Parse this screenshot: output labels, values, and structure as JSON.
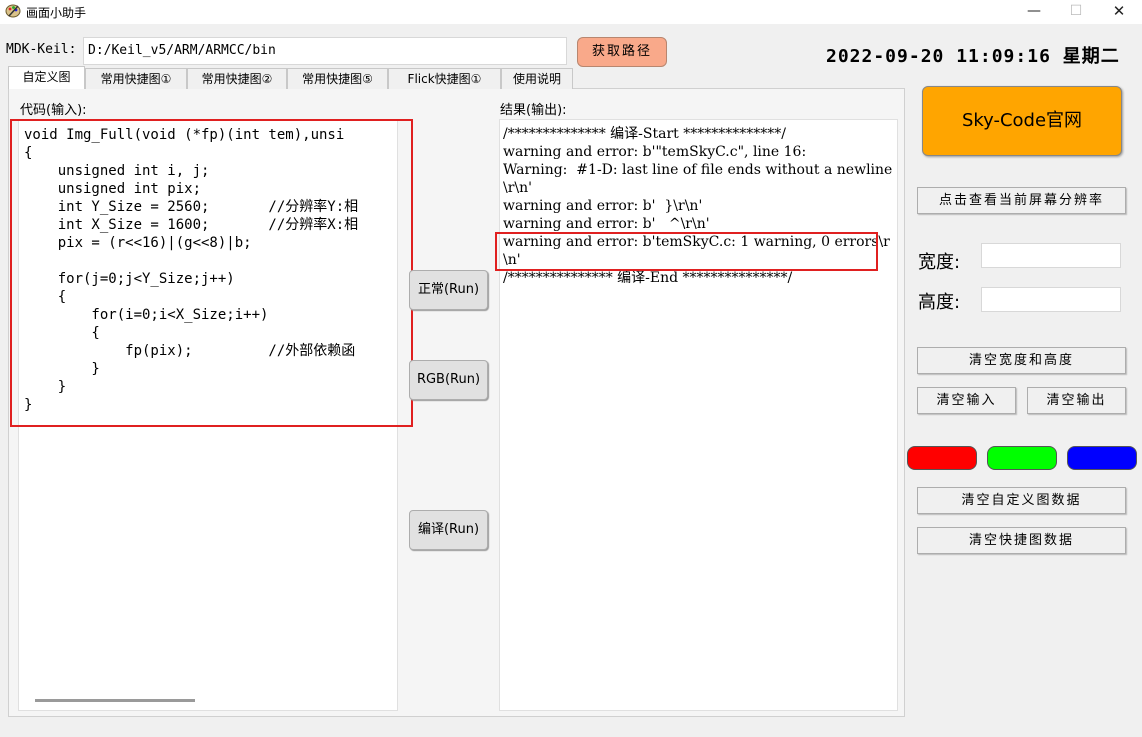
{
  "window": {
    "title": "画面小助手",
    "app_icon": "palette-icon",
    "min": "—",
    "max": "☐",
    "close": "✕"
  },
  "mdk": {
    "label": "MDK-Keil:",
    "path": "D:/Keil_v5/ARM/ARMCC/bin",
    "get_path_button": "获取路径"
  },
  "datetime": "2022-09-20  11:09:16  星期二",
  "tabs": [
    {
      "label": "自定义图",
      "active": true
    },
    {
      "label": "常用快捷图①"
    },
    {
      "label": "常用快捷图②"
    },
    {
      "label": "常用快捷图⑤"
    },
    {
      "label": "Flick快捷图①"
    },
    {
      "label": "使用说明"
    }
  ],
  "code": {
    "label": "代码(输入):",
    "text": "void Img_Full(void (*fp)(int tem),unsi\n{\n    unsigned int i, j;\n    unsigned int pix;\n    int Y_Size = 2560;       //分辨率Y:相\n    int X_Size = 1600;       //分辨率X:相\n    pix = (r<<16)|(g<<8)|b;\n\n    for(j=0;j<Y_Size;j++)\n    {\n        for(i=0;i<X_Size;i++)\n        {\n            fp(pix);         //外部依赖函\n        }\n    }\n}"
  },
  "run_buttons": {
    "normal": "正常(Run)",
    "rgb": "RGB(Run)",
    "compile": "编译(Run)"
  },
  "result": {
    "label": "结果(输出):",
    "text": "/************** 编译-Start **************/\nwarning and error: b'\"temSkyC.c\", line 16:\nWarning:  #1-D: last line of file ends without a newline\\r\\n'\nwarning and error: b'  }\\r\\n'\nwarning and error: b'   ^\\r\\n'\nwarning and error: b'temSkyC.c: 1 warning, 0 errors\\r\\n'\n/*************** 编译-End ***************/"
  },
  "right_panel": {
    "skycode_button": "Sky-Code官网",
    "resolution_button": "点击查看当前屏幕分辨率",
    "width_label": "宽度:",
    "height_label": "高度:",
    "width_value": "",
    "height_value": "",
    "clear_wh_button": "清空宽度和高度",
    "clear_input_button": "清空输入",
    "clear_output_button": "清空输出",
    "color_buttons": [
      "#ff0000",
      "#00ff00",
      "#0000ff"
    ],
    "clear_custom_button": "清空自定义图数据",
    "clear_quick_button": "清空快捷图数据"
  },
  "colors": {
    "highlight_border": "#e02020",
    "get_path_bg": "#f9a98a",
    "skycode_bg": "#ffa500"
  }
}
